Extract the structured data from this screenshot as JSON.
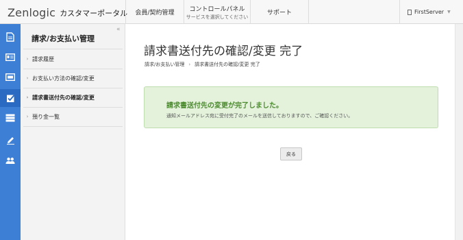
{
  "header": {
    "logo": "Zenlogic",
    "portal": "カスタマーポータル",
    "nav": [
      {
        "label": "会員/契約管理",
        "sub": ""
      },
      {
        "label": "コントロールパネル",
        "sub": "サービスを選択してください"
      },
      {
        "label": "サポート",
        "sub": ""
      }
    ],
    "user": "FirstServer"
  },
  "rail": {
    "icons": [
      "document-icon",
      "id-card-icon",
      "payment-card-icon",
      "checkbox-icon",
      "server-icon",
      "pen-icon",
      "users-icon"
    ]
  },
  "sidebar": {
    "title": "請求/お支払い管理",
    "collapse": "«",
    "items": [
      {
        "label": "請求履歴"
      },
      {
        "label": "お支払い方法の確認/変更"
      },
      {
        "label": "請求書送付先の確認/変更"
      },
      {
        "label": "預り金一覧"
      }
    ]
  },
  "main": {
    "title": "請求書送付先の確認/変更 完了",
    "breadcrumb": [
      "請求/お支払い管理",
      "請求書送付先の確認/変更 完了"
    ],
    "alert": {
      "title": "請求書送付先の変更が完了しました。",
      "text": "通知メールアドレス宛に受付完了のメールを送信しておりますので、ご確認ください。"
    },
    "back_button": "戻る"
  },
  "colors": {
    "rail": "#3c7fd4",
    "rail_active": "#2a6ac2",
    "alert_bg": "#e4f2dc",
    "alert_title": "#4c8a2f"
  }
}
